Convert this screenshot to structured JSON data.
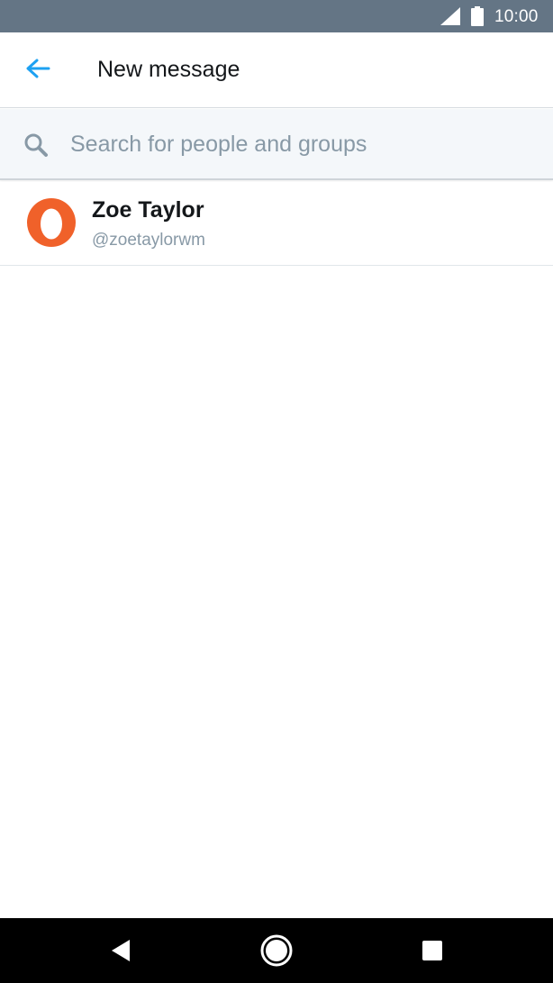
{
  "status_bar": {
    "time": "10:00",
    "icons": [
      "signal-icon",
      "battery-icon"
    ]
  },
  "header": {
    "title": "New message",
    "back_icon": "back-arrow-icon",
    "accent_color": "#1da1f2"
  },
  "search": {
    "placeholder": "Search for people and groups",
    "value": "",
    "icon": "search-icon"
  },
  "results": [
    {
      "name": "Zoe Taylor",
      "handle": "@zoetaylorwm",
      "avatar_color": "#f0612a"
    }
  ],
  "nav_bar": {
    "icons": [
      "nav-back-icon",
      "nav-home-icon",
      "nav-recents-icon"
    ]
  }
}
